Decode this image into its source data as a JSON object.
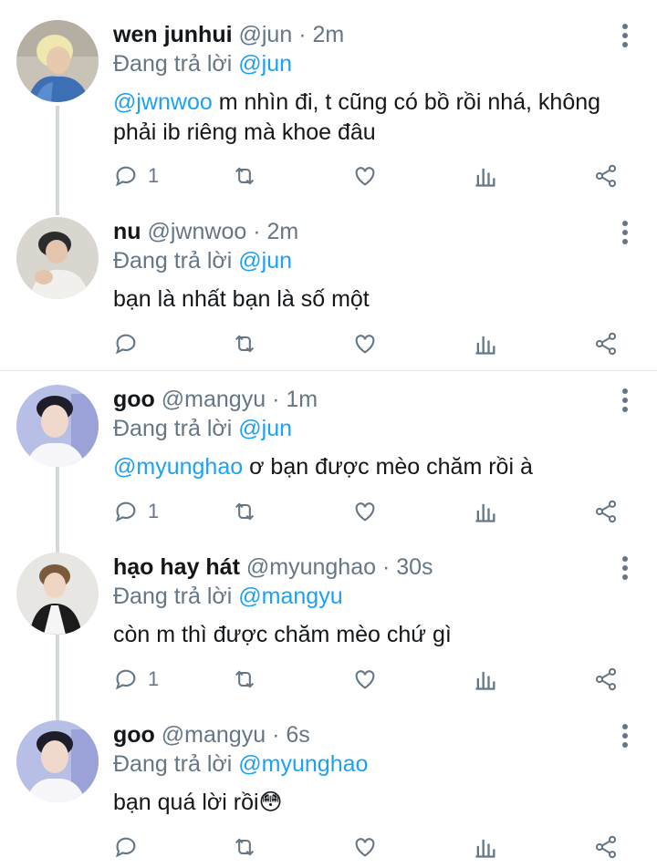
{
  "replying_label": "Đang trả lời",
  "tweets": [
    {
      "name": "wen junhui",
      "handle": "@jun",
      "time": "· 2m",
      "reply_to": "@jun",
      "mention": "@jwnwoo",
      "text": " m nhìn đi, t cũng có bồ rồi nhá, không phải ib riêng mà khoe đâu",
      "reply_count": "1"
    },
    {
      "name": "nu",
      "handle": "@jwnwoo",
      "time": "· 2m",
      "reply_to": "@jun",
      "mention": "",
      "text": "bạn là nhất bạn là số một",
      "reply_count": ""
    },
    {
      "name": "goo",
      "handle": "@mangyu",
      "time": "· 1m",
      "reply_to": "@jun",
      "mention": "@myunghao",
      "text": " ơ bạn được mèo chăm rồi à",
      "reply_count": "1"
    },
    {
      "name": "hạo hay hát",
      "handle": "@myunghao",
      "time": "· 30s",
      "reply_to": "@mangyu",
      "mention": "",
      "text": "còn m thì được chăm mèo chứ gì",
      "reply_count": "1"
    },
    {
      "name": "goo",
      "handle": "@mangyu",
      "time": "· 6s",
      "reply_to": "@myunghao",
      "mention": "",
      "text": "bạn quá lời rồi😳",
      "reply_count": ""
    }
  ],
  "icons": [
    "reply-icon",
    "retweet-icon",
    "like-icon",
    "analytics-icon",
    "share-icon",
    "more-icon"
  ],
  "colors": {
    "link": "#1da1f2",
    "muted": "#657786",
    "text": "#14171a",
    "thread_line": "#cfd9de"
  }
}
